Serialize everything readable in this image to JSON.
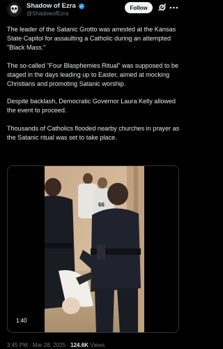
{
  "author": {
    "display_name": "Shadow of Ezra",
    "handle": "@ShadowofEzra",
    "verified_color": "#1d9bf0",
    "avatar_icon": "punisher-skull-avatar"
  },
  "actions": {
    "follow_label": "Follow",
    "grok_icon": "grok-icon",
    "more_icon": "more-options-icon"
  },
  "tweet": {
    "paragraphs": [
      "The leader of the Satanic Grotto was arrested at the Kansas State Capitol for assaulting a Catholic during an attempted \"Black Mass.\"",
      "The so-called \"Four Blasphemies Ritual\" was supposed to be staged in the days leading up to Easter, aimed at mocking Christians and promoting Satanic worship.",
      "Despite backlash, Democratic Governor Laura Kelly allowed the event to proceed.",
      "Thousands of Catholics flooded nearby churches in prayer as the Satanic ritual was set to take place."
    ]
  },
  "video": {
    "duration": "1:40"
  },
  "meta": {
    "time": "3:45 PM",
    "separator": " · ",
    "date": "Mar 28, 2025",
    "views_count": "124.6K",
    "views_label": " Views"
  },
  "colors": {
    "background": "#000000",
    "text_primary": "#e7e9ea",
    "text_secondary": "#71767b",
    "accent": "#1d9bf0",
    "follow_bg": "#eff3f4"
  }
}
